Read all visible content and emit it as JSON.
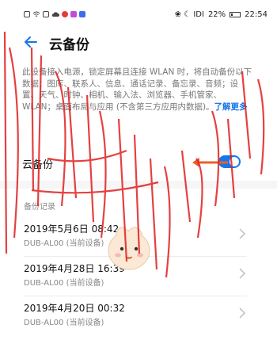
{
  "status_bar": {
    "left_icons": [
      "sim-icon",
      "wifi-icon",
      "shield-icon",
      "cloud-icon",
      "app-red-icon",
      "app-purple-icon",
      "app-blue-icon"
    ],
    "right_text": "❀ ☾ IDI",
    "battery_percent": "22%",
    "battery_level": 0.22,
    "time": "22:54"
  },
  "header": {
    "title": "云备份"
  },
  "description": {
    "text": "此设备接入电源，锁定屏幕且连接 WLAN 时，将自动备份以下数据：图库、联系人、信息、通话记录、备忘录、音频；设置、天气、时钟、相机、输入法、浏览器、手机管家、WLAN；桌面布局与应用 (不含第三方应用内数据)。",
    "learn_more": "了解更多"
  },
  "cloud_backup": {
    "label": "云备份",
    "enabled": true
  },
  "records": {
    "header": "备份记录",
    "items": [
      {
        "date": "2019年5月6日 08:42",
        "device": "DUB-AL00 (当前设备)"
      },
      {
        "date": "2019年4月28日 16:39",
        "device": "DUB-AL00 (当前设备)"
      },
      {
        "date": "2019年4月20日 00:32",
        "device": "DUB-AL00 (当前设备)"
      }
    ]
  },
  "colors": {
    "accent": "#1976e8",
    "annotation_arrow": "#e8602c",
    "watermark": "#e02020"
  }
}
